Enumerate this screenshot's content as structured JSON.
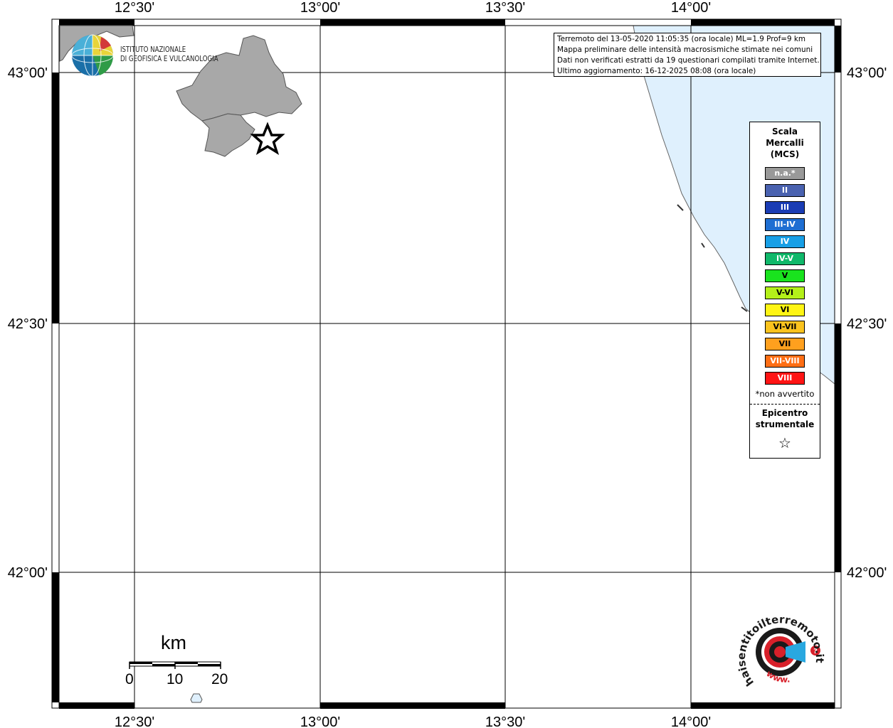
{
  "top_axis_labels": [
    "12°30'",
    "13°00'",
    "13°30'",
    "14°00'"
  ],
  "bottom_axis_labels": [
    "12°30'",
    "13°00'",
    "13°30'",
    "14°00'"
  ],
  "left_axis_labels": [
    "43°00'",
    "42°30'",
    "42°00'"
  ],
  "right_axis_labels": [
    "43°00'",
    "42°30'",
    "42°00'"
  ],
  "info_box": {
    "line1": "Terremoto del 13-05-2020 11:05:35 (ora locale) ML=1.9 Prof=9 km",
    "line2": "Mappa preliminare delle intensità macrosismiche stimate nei comuni",
    "line3": "Dati non verificati estratti da 19 questionari compilati tramite Internet.",
    "line4": "Ultimo aggiornamento: 16-12-2025 08:08 (ora locale)"
  },
  "institute": {
    "line1": "ISTITUTO NAZIONALE",
    "line2": "DI GEOFISICA E VULCANOLOGIA"
  },
  "legend": {
    "title_line1": "Scala",
    "title_line2": "Mercalli",
    "title_line3": "(MCS)",
    "items": [
      {
        "label": "n.a.*",
        "color": "#999999"
      },
      {
        "label": "II",
        "color": "#4a62b0"
      },
      {
        "label": "III",
        "color": "#1a3cb4"
      },
      {
        "label": "III-IV",
        "color": "#1e6ed2"
      },
      {
        "label": "IV",
        "color": "#189fe6"
      },
      {
        "label": "IV-V",
        "color": "#10b86a"
      },
      {
        "label": "V",
        "color": "#19e31e"
      },
      {
        "label": "V-VI",
        "color": "#b4f019"
      },
      {
        "label": "VI",
        "color": "#fff514"
      },
      {
        "label": "VI-VII",
        "color": "#fac31e"
      },
      {
        "label": "VII",
        "color": "#ffa01e"
      },
      {
        "label": "VII-VIII",
        "color": "#ff6e14"
      },
      {
        "label": "VIII",
        "color": "#ff1414"
      }
    ],
    "note": "*non avvertito",
    "epicenter_line1": "Epicentro",
    "epicenter_line2": "strumentale",
    "star_symbol": "☆"
  },
  "scale_bar": {
    "title": "km",
    "labels": [
      "0",
      "10",
      "20"
    ]
  },
  "website_logo": {
    "text": "haisentitoilterremoto.it",
    "prefix": "www."
  },
  "colors": {
    "sea": "#dff0fd",
    "municipalities": "#a8a8a8",
    "frame": "#000000"
  }
}
